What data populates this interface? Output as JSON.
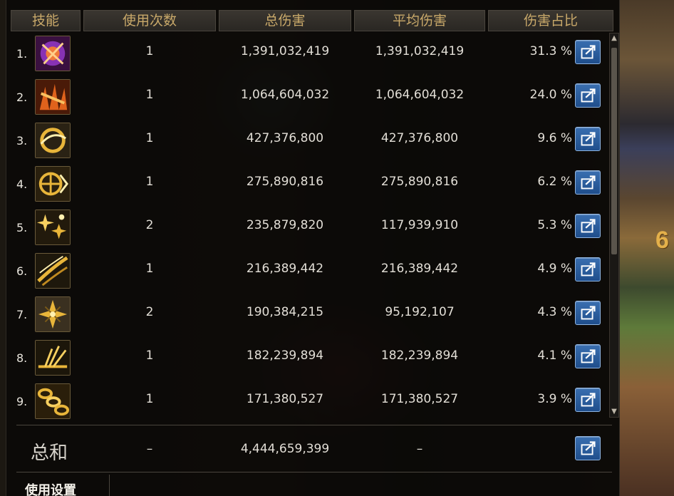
{
  "header": {
    "skill": "技能",
    "uses": "使用次数",
    "total_damage": "总伤害",
    "avg_damage": "平均伤害",
    "damage_share": "伤害占比"
  },
  "rows": [
    {
      "rank": "1.",
      "icon": "purple-burst-skill-icon",
      "uses": "1",
      "total": "1,391,032,419",
      "avg": "1,391,032,419",
      "pct": "31.3 %"
    },
    {
      "rank": "2.",
      "icon": "fire-chain-skill-icon",
      "uses": "1",
      "total": "1,064,604,032",
      "avg": "1,064,604,032",
      "pct": "24.0 %"
    },
    {
      "rank": "3.",
      "icon": "golden-vortex-skill-icon",
      "uses": "1",
      "total": "427,376,800",
      "avg": "427,376,800",
      "pct": "9.6 %"
    },
    {
      "rank": "4.",
      "icon": "golden-wheel-skill-icon",
      "uses": "1",
      "total": "275,890,816",
      "avg": "275,890,816",
      "pct": "6.2 %"
    },
    {
      "rank": "5.",
      "icon": "golden-sparks-skill-icon",
      "uses": "2",
      "total": "235,879,820",
      "avg": "117,939,910",
      "pct": "5.3 %"
    },
    {
      "rank": "6.",
      "icon": "golden-slash-skill-icon",
      "uses": "1",
      "total": "216,389,442",
      "avg": "216,389,442",
      "pct": "4.9 %"
    },
    {
      "rank": "7.",
      "icon": "golden-shuriken-skill-icon",
      "uses": "2",
      "total": "190,384,215",
      "avg": "95,192,107",
      "pct": "4.3 %"
    },
    {
      "rank": "8.",
      "icon": "golden-strike-skill-icon",
      "uses": "1",
      "total": "182,239,894",
      "avg": "182,239,894",
      "pct": "4.1 %"
    },
    {
      "rank": "9.",
      "icon": "golden-chain-skill-icon",
      "uses": "1",
      "total": "171,380,527",
      "avg": "171,380,527",
      "pct": "3.9 %"
    }
  ],
  "total": {
    "label": "总和",
    "uses": "–",
    "total": "4,444,659,399",
    "avg": "–"
  },
  "footer": {
    "settings_label": "使用设置"
  },
  "background": {
    "side_number": "6"
  },
  "colors": {
    "header_text": "#c9a96a",
    "share_button": "#2b5f9e",
    "icon_gold": "#e8b53a",
    "icon_purple": "#9b3bd1",
    "icon_orange": "#e0621c"
  }
}
